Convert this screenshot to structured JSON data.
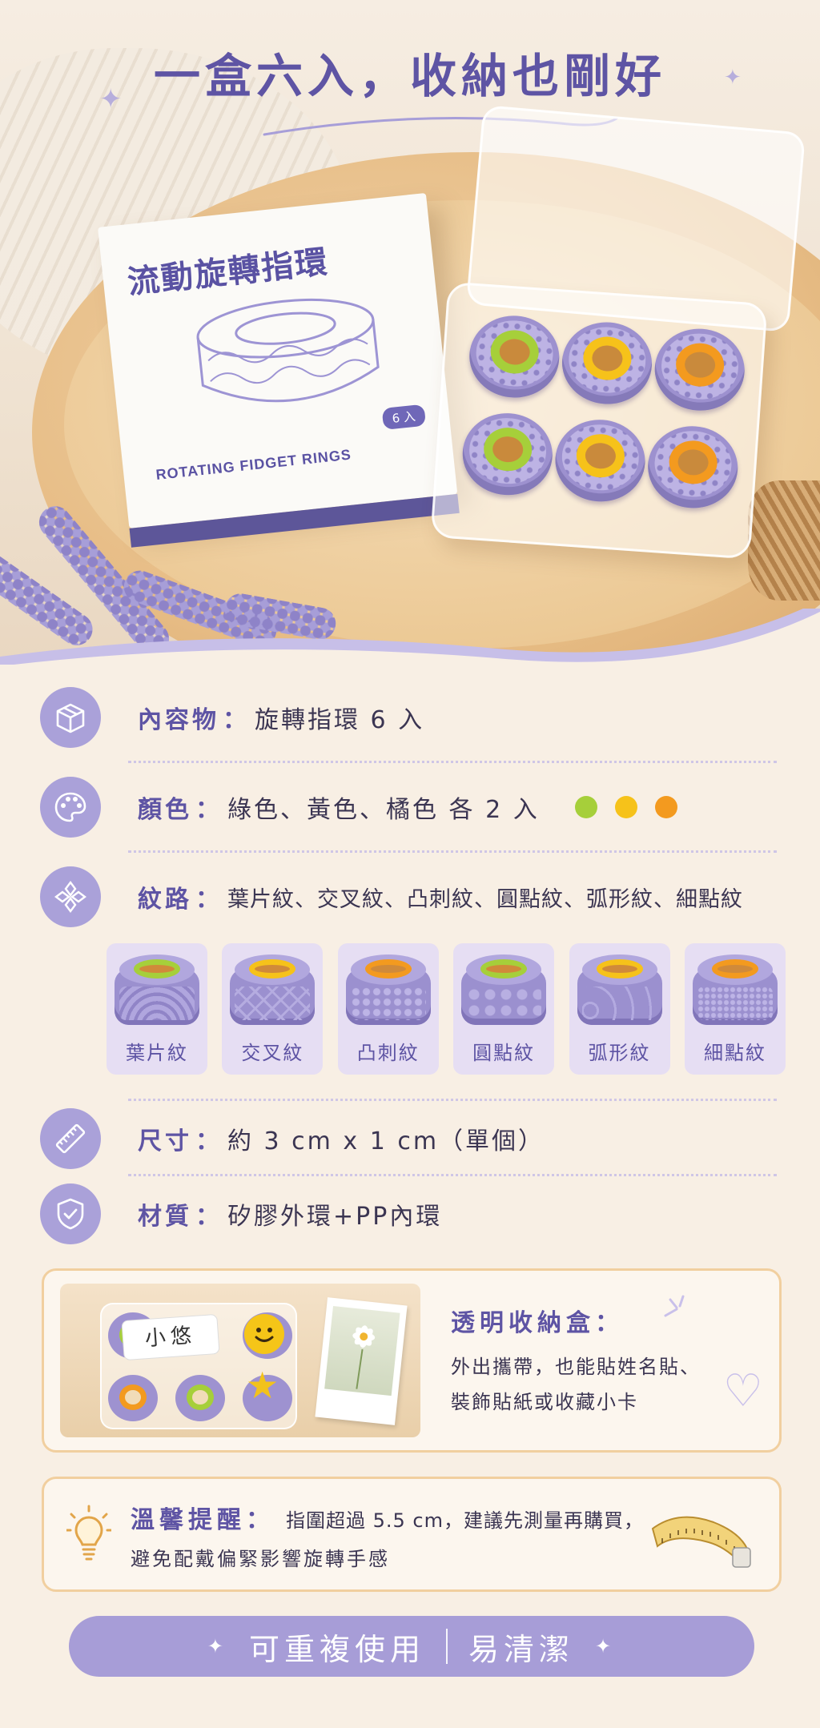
{
  "hero": {
    "title": "一盒六入，收納也剛好",
    "package_title": "流動旋轉指環",
    "package_badge": "6 入",
    "package_subtitle": "ROTATING FIDGET RINGS"
  },
  "specs": {
    "contents": {
      "label": "內容物",
      "colon": "：",
      "value": "旋轉指環 6 入",
      "icon": "box-icon"
    },
    "color": {
      "label": "顏色",
      "colon": "：",
      "value": "綠色、黃色、橘色 各 2 入",
      "icon": "palette-icon",
      "swatches": [
        "#a6cf3a",
        "#f6c21a",
        "#f39a1f"
      ]
    },
    "pattern": {
      "label": "紋路",
      "colon": "：",
      "value": "葉片紋、交叉紋、凸刺紋、圓點紋、弧形紋、細點紋",
      "icon": "pattern-icon"
    },
    "size": {
      "label": "尺寸",
      "colon": "：",
      "value": "約 3 cm x 1 cm（單個）",
      "icon": "ruler-icon"
    },
    "material": {
      "label": "材質",
      "colon": "：",
      "value": "矽膠外環+PP內環",
      "icon": "shield-check-icon"
    }
  },
  "patterns": [
    {
      "label": "葉片紋",
      "core_color": "#a6cf3a"
    },
    {
      "label": "交叉紋",
      "core_color": "#f6c21a"
    },
    {
      "label": "凸刺紋",
      "core_color": "#f39a1f"
    },
    {
      "label": "圓點紋",
      "core_color": "#a6cf3a"
    },
    {
      "label": "弧形紋",
      "core_color": "#f6c21a"
    },
    {
      "label": "細點紋",
      "core_color": "#f39a1f"
    }
  ],
  "storage": {
    "title": "透明收納盒：",
    "desc_line1": "外出攜帶，也能貼姓名貼、",
    "desc_line2": "裝飾貼紙或收藏小卡",
    "name_tag": "小悠"
  },
  "reminder": {
    "title": "溫馨提醒：",
    "text": "指圍超過 5.5 cm，建議先測量再購買，",
    "text2": "避免配戴偏緊影響旋轉手感"
  },
  "banner": {
    "left": "可重複使用",
    "right": "易清潔"
  },
  "colors": {
    "accent": "#5e54a4",
    "lavender": "#aaa1d9",
    "cream": "#f8efe4",
    "gold_border": "#f1cf9f"
  }
}
